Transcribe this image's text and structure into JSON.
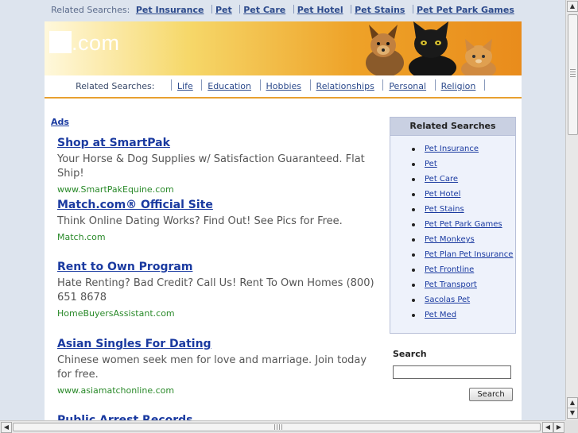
{
  "top_related": {
    "label": "Related Searches:",
    "links": [
      "Pet Insurance",
      "Pet",
      "Pet Care",
      "Pet Hotel",
      "Pet Stains",
      "Pet Pet Park Games"
    ]
  },
  "header": {
    "domain": ".com"
  },
  "navbar": {
    "label": "Related Searches:",
    "links": [
      "Life",
      "Education",
      "Hobbies",
      "Relationships",
      "Personal",
      "Religion"
    ]
  },
  "ads": {
    "label": "Ads",
    "items": [
      {
        "title": "Shop at SmartPak",
        "desc": "Your Horse & Dog Supplies w/ Satisfaction Guaranteed. Flat Ship!",
        "url": "www.SmartPakEquine.com"
      },
      {
        "title": "Match.com® Official Site",
        "desc": "Think Online Dating Works? Find Out! See Pics for Free.",
        "url": "Match.com"
      },
      {
        "title": "Rent to Own Program",
        "desc": "Hate Renting? Bad Credit? Call Us! Rent To Own Homes (800) 651 8678",
        "url": "HomeBuyersAssistant.com"
      },
      {
        "title": "Asian Singles For Dating",
        "desc": "Chinese women seek men for love and marriage. Join today for free.",
        "url": "www.asiamatchonline.com"
      },
      {
        "title": "Public Arrest Records",
        "desc": "",
        "url": ""
      }
    ]
  },
  "sidebar": {
    "title": "Related Searches",
    "links": [
      "Pet Insurance",
      "Pet",
      "Pet Care",
      "Pet Hotel",
      "Pet Stains",
      "Pet Pet Park Games",
      "Pet Monkeys",
      "Pet Plan Pet Insurance",
      "Pet Frontline",
      "Pet Transport",
      "Sacolas Pet",
      "Pet Med"
    ]
  },
  "search": {
    "label": "Search",
    "button": "Search",
    "value": "",
    "placeholder": ""
  },
  "icons": {
    "scroll_up": "arrow-up-icon",
    "scroll_down": "arrow-down-icon",
    "scroll_left": "arrow-left-icon",
    "scroll_right": "arrow-right-icon",
    "header_image": "dog-and-cats-photo"
  },
  "colors": {
    "link": "#1a3aa0",
    "url_green": "#2a8a2a",
    "header_orange": "#e98c1c",
    "accent_border": "#e8a030"
  }
}
